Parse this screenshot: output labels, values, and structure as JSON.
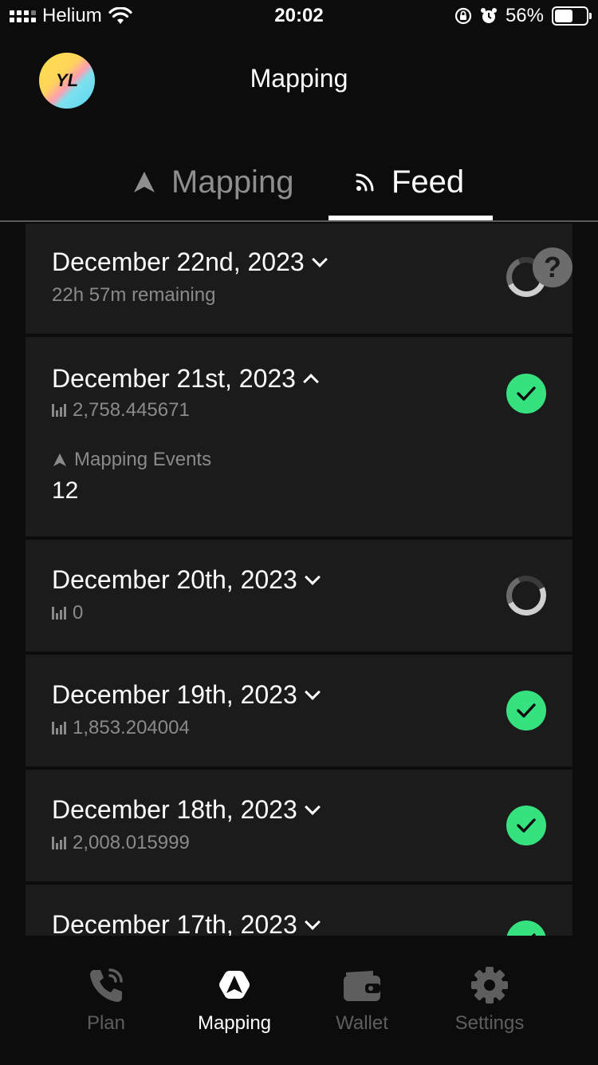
{
  "status_bar": {
    "carrier": "Helium",
    "time": "20:02",
    "battery": "56%"
  },
  "header": {
    "avatar_initials": "YL",
    "title": "Mapping"
  },
  "tabs": [
    {
      "label": "Mapping",
      "icon": "navigation-arrow-icon",
      "active": false
    },
    {
      "label": "Feed",
      "icon": "rss-feed-icon",
      "active": true
    }
  ],
  "feed": {
    "items": [
      {
        "date": "December 22nd, 2023",
        "subtitle": "22h 57m remaining",
        "status": "pending-unknown",
        "expanded": false
      },
      {
        "date": "December 21st, 2023",
        "subtitle": "2,758.445671",
        "status": "complete",
        "expanded": true,
        "events_label": "Mapping Events",
        "events_value": "12"
      },
      {
        "date": "December 20th, 2023",
        "subtitle": "0",
        "status": "pending",
        "expanded": false
      },
      {
        "date": "December 19th, 2023",
        "subtitle": "1,853.204004",
        "status": "complete",
        "expanded": false
      },
      {
        "date": "December 18th, 2023",
        "subtitle": "2,008.015999",
        "status": "complete",
        "expanded": false
      },
      {
        "date": "December 17th, 2023",
        "subtitle": "",
        "status": "complete",
        "expanded": false
      }
    ]
  },
  "bottom_nav": [
    {
      "label": "Plan",
      "icon": "phone-signal-icon",
      "active": false
    },
    {
      "label": "Mapping",
      "icon": "navigation-arrow-icon",
      "active": true
    },
    {
      "label": "Wallet",
      "icon": "wallet-icon",
      "active": false
    },
    {
      "label": "Settings",
      "icon": "gear-icon",
      "active": false
    }
  ],
  "colors": {
    "background": "#0c0c0c",
    "card": "#1b1b1b",
    "success": "#36e27f",
    "muted_text": "#8a8a8a"
  }
}
